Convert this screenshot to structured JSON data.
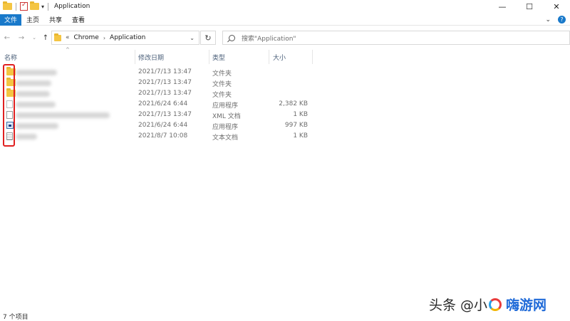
{
  "window": {
    "title": "Application",
    "controls": [
      "—",
      "☐",
      "✕"
    ]
  },
  "ribbon": {
    "tabs": [
      "文件",
      "主页",
      "共享",
      "查看"
    ],
    "right_icons": [
      "chevron-down-icon",
      "help-icon"
    ]
  },
  "address": {
    "overflow": "«",
    "crumbs": [
      "Chrome",
      "Application"
    ],
    "search_placeholder": "搜索\"Application\""
  },
  "columns": {
    "name": "名称",
    "date": "修改日期",
    "type": "类型",
    "size": "大小"
  },
  "files": [
    {
      "icon": "folder-icon",
      "date": "2021/7/13 13:47",
      "type": "文件夹",
      "size": ""
    },
    {
      "icon": "folder-icon",
      "date": "2021/7/13 13:47",
      "type": "文件夹",
      "size": ""
    },
    {
      "icon": "folder-icon",
      "date": "2021/7/13 13:47",
      "type": "文件夹",
      "size": ""
    },
    {
      "icon": "file-icon",
      "date": "2021/6/24 6:44",
      "type": "应用程序",
      "size": "2,382 KB"
    },
    {
      "icon": "file-icon",
      "date": "2021/7/13 13:47",
      "type": "XML 文档",
      "size": "1 KB"
    },
    {
      "icon": "app-icon",
      "date": "2021/6/24 6:44",
      "type": "应用程序",
      "size": "997 KB"
    },
    {
      "icon": "text-file-icon",
      "date": "2021/8/7 10:08",
      "type": "文本文档",
      "size": "1 KB"
    }
  ],
  "status": {
    "item_count": "7 个项目"
  },
  "watermark": {
    "prefix": "头条 @小",
    "brand": "嗨游网"
  },
  "colors": {
    "accent": "#1979ca",
    "highlight": "#e02020",
    "folder": "#f4c542"
  }
}
